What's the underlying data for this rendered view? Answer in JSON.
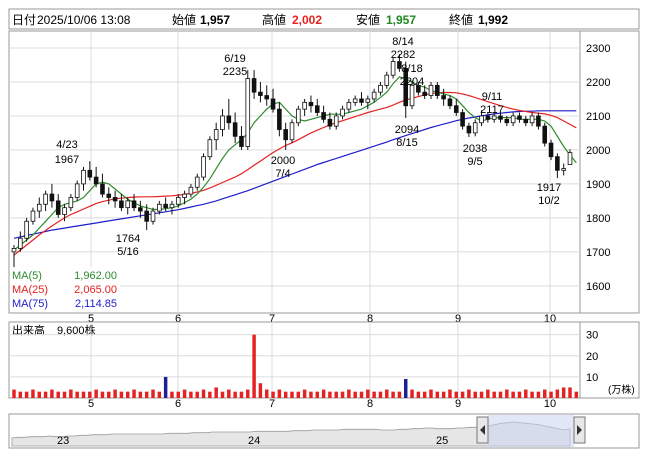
{
  "header": {
    "date_label": "日付",
    "date_value": "2025/10/06 13:08",
    "open_label": "始値",
    "open_value": "1,957",
    "high_label": "高値",
    "high_value": "2,002",
    "low_label": "安値",
    "low_value": "1,957",
    "close_label": "終値",
    "close_value": "1,992"
  },
  "legend": {
    "ma5_label": "MA(5)",
    "ma5_value": "1,962.00",
    "ma25_label": "MA(25)",
    "ma25_value": "2,065.00",
    "ma75_label": "MA(75)",
    "ma75_value": "2,114.85"
  },
  "volume_panel": {
    "title": "出来高",
    "value": "9,600株",
    "unit": "(万株)"
  },
  "annotations": [
    {
      "date": "4/23",
      "price": "1967"
    },
    {
      "date": "6/19",
      "price": "2235"
    },
    {
      "date": "5/16",
      "price": "1764"
    },
    {
      "date": "7/4",
      "price": "2000"
    },
    {
      "date": "8/14",
      "price": "2282"
    },
    {
      "date": "8/18",
      "price": "2204"
    },
    {
      "date": "8/15",
      "price": "2094"
    },
    {
      "date": "9/11",
      "price": "2117"
    },
    {
      "date": "9/5",
      "price": "2038"
    },
    {
      "date": "10/2",
      "price": "1917"
    }
  ],
  "navigator_labels": [
    "23",
    "24",
    "25"
  ],
  "colors": {
    "up": "#1e1e96",
    "down": "#e52222",
    "ma5": "#2e8b2e",
    "ma25": "#e52222",
    "ma75": "#1e1ec8",
    "volume": "#e52222"
  },
  "chart_data": {
    "type": "candlestick",
    "x_tick_labels": [
      "5",
      "6",
      "7",
      "8",
      "9",
      "10"
    ],
    "y_ticks": [
      1600,
      1700,
      1800,
      1900,
      2000,
      2100,
      2200,
      2300
    ],
    "ylim": [
      1520,
      2350
    ],
    "volume_ticks": [
      10,
      20,
      30
    ],
    "volume_ylim": [
      0,
      36
    ],
    "candles": [
      {
        "o": 1700,
        "h": 1720,
        "l": 1650,
        "c": 1710
      },
      {
        "o": 1710,
        "h": 1760,
        "l": 1700,
        "c": 1740
      },
      {
        "o": 1740,
        "h": 1800,
        "l": 1730,
        "c": 1790
      },
      {
        "o": 1790,
        "h": 1830,
        "l": 1780,
        "c": 1820
      },
      {
        "o": 1820,
        "h": 1860,
        "l": 1800,
        "c": 1840
      },
      {
        "o": 1840,
        "h": 1880,
        "l": 1820,
        "c": 1870
      },
      {
        "o": 1870,
        "h": 1900,
        "l": 1830,
        "c": 1850
      },
      {
        "o": 1850,
        "h": 1870,
        "l": 1800,
        "c": 1810
      },
      {
        "o": 1810,
        "h": 1840,
        "l": 1790,
        "c": 1830
      },
      {
        "o": 1830,
        "h": 1870,
        "l": 1820,
        "c": 1860
      },
      {
        "o": 1860,
        "h": 1910,
        "l": 1850,
        "c": 1900
      },
      {
        "o": 1900,
        "h": 1950,
        "l": 1880,
        "c": 1940
      },
      {
        "o": 1940,
        "h": 1967,
        "l": 1910,
        "c": 1920
      },
      {
        "o": 1920,
        "h": 1950,
        "l": 1890,
        "c": 1900
      },
      {
        "o": 1900,
        "h": 1930,
        "l": 1860,
        "c": 1870
      },
      {
        "o": 1870,
        "h": 1890,
        "l": 1840,
        "c": 1860
      },
      {
        "o": 1860,
        "h": 1880,
        "l": 1830,
        "c": 1850
      },
      {
        "o": 1850,
        "h": 1870,
        "l": 1820,
        "c": 1830
      },
      {
        "o": 1830,
        "h": 1860,
        "l": 1810,
        "c": 1850
      },
      {
        "o": 1850,
        "h": 1870,
        "l": 1820,
        "c": 1830
      },
      {
        "o": 1830,
        "h": 1850,
        "l": 1800,
        "c": 1820
      },
      {
        "o": 1820,
        "h": 1840,
        "l": 1764,
        "c": 1790
      },
      {
        "o": 1790,
        "h": 1830,
        "l": 1780,
        "c": 1820
      },
      {
        "o": 1820,
        "h": 1850,
        "l": 1810,
        "c": 1840
      },
      {
        "o": 1840,
        "h": 1860,
        "l": 1820,
        "c": 1830
      },
      {
        "o": 1830,
        "h": 1850,
        "l": 1810,
        "c": 1840
      },
      {
        "o": 1840,
        "h": 1870,
        "l": 1830,
        "c": 1860
      },
      {
        "o": 1860,
        "h": 1880,
        "l": 1840,
        "c": 1870
      },
      {
        "o": 1870,
        "h": 1900,
        "l": 1860,
        "c": 1890
      },
      {
        "o": 1890,
        "h": 1930,
        "l": 1880,
        "c": 1920
      },
      {
        "o": 1920,
        "h": 1990,
        "l": 1910,
        "c": 1980
      },
      {
        "o": 1980,
        "h": 2040,
        "l": 1970,
        "c": 2030
      },
      {
        "o": 2030,
        "h": 2080,
        "l": 2000,
        "c": 2060
      },
      {
        "o": 2060,
        "h": 2120,
        "l": 2040,
        "c": 2100
      },
      {
        "o": 2100,
        "h": 2150,
        "l": 2060,
        "c": 2080
      },
      {
        "o": 2080,
        "h": 2110,
        "l": 2020,
        "c": 2040
      },
      {
        "o": 2040,
        "h": 2070,
        "l": 2000,
        "c": 2010
      },
      {
        "o": 2010,
        "h": 2235,
        "l": 2000,
        "c": 2210
      },
      {
        "o": 2210,
        "h": 2235,
        "l": 2150,
        "c": 2170
      },
      {
        "o": 2170,
        "h": 2200,
        "l": 2140,
        "c": 2160
      },
      {
        "o": 2160,
        "h": 2190,
        "l": 2130,
        "c": 2150
      },
      {
        "o": 2150,
        "h": 2180,
        "l": 2110,
        "c": 2120
      },
      {
        "o": 2120,
        "h": 2140,
        "l": 2040,
        "c": 2060
      },
      {
        "o": 2060,
        "h": 2080,
        "l": 2000,
        "c": 2030
      },
      {
        "o": 2030,
        "h": 2090,
        "l": 2020,
        "c": 2080
      },
      {
        "o": 2080,
        "h": 2130,
        "l": 2070,
        "c": 2120
      },
      {
        "o": 2120,
        "h": 2150,
        "l": 2100,
        "c": 2140
      },
      {
        "o": 2140,
        "h": 2160,
        "l": 2110,
        "c": 2130
      },
      {
        "o": 2130,
        "h": 2150,
        "l": 2100,
        "c": 2110
      },
      {
        "o": 2110,
        "h": 2130,
        "l": 2080,
        "c": 2090
      },
      {
        "o": 2090,
        "h": 2110,
        "l": 2060,
        "c": 2070
      },
      {
        "o": 2070,
        "h": 2110,
        "l": 2060,
        "c": 2100
      },
      {
        "o": 2100,
        "h": 2130,
        "l": 2090,
        "c": 2120
      },
      {
        "o": 2120,
        "h": 2150,
        "l": 2110,
        "c": 2140
      },
      {
        "o": 2140,
        "h": 2160,
        "l": 2130,
        "c": 2150
      },
      {
        "o": 2150,
        "h": 2170,
        "l": 2130,
        "c": 2140
      },
      {
        "o": 2140,
        "h": 2160,
        "l": 2120,
        "c": 2150
      },
      {
        "o": 2150,
        "h": 2180,
        "l": 2140,
        "c": 2170
      },
      {
        "o": 2170,
        "h": 2200,
        "l": 2160,
        "c": 2190
      },
      {
        "o": 2190,
        "h": 2230,
        "l": 2180,
        "c": 2220
      },
      {
        "o": 2220,
        "h": 2270,
        "l": 2210,
        "c": 2260
      },
      {
        "o": 2260,
        "h": 2282,
        "l": 2230,
        "c": 2240
      },
      {
        "o": 2240,
        "h": 2260,
        "l": 2094,
        "c": 2130
      },
      {
        "o": 2130,
        "h": 2204,
        "l": 2120,
        "c": 2190
      },
      {
        "o": 2190,
        "h": 2200,
        "l": 2160,
        "c": 2170
      },
      {
        "o": 2170,
        "h": 2190,
        "l": 2150,
        "c": 2160
      },
      {
        "o": 2160,
        "h": 2200,
        "l": 2150,
        "c": 2190
      },
      {
        "o": 2190,
        "h": 2200,
        "l": 2150,
        "c": 2160
      },
      {
        "o": 2160,
        "h": 2180,
        "l": 2130,
        "c": 2150
      },
      {
        "o": 2150,
        "h": 2160,
        "l": 2120,
        "c": 2130
      },
      {
        "o": 2130,
        "h": 2150,
        "l": 2100,
        "c": 2110
      },
      {
        "o": 2110,
        "h": 2120,
        "l": 2060,
        "c": 2070
      },
      {
        "o": 2070,
        "h": 2080,
        "l": 2038,
        "c": 2050
      },
      {
        "o": 2050,
        "h": 2090,
        "l": 2040,
        "c": 2080
      },
      {
        "o": 2080,
        "h": 2117,
        "l": 2070,
        "c": 2100
      },
      {
        "o": 2100,
        "h": 2110,
        "l": 2080,
        "c": 2090
      },
      {
        "o": 2090,
        "h": 2110,
        "l": 2080,
        "c": 2100
      },
      {
        "o": 2100,
        "h": 2110,
        "l": 2080,
        "c": 2090
      },
      {
        "o": 2090,
        "h": 2100,
        "l": 2070,
        "c": 2080
      },
      {
        "o": 2080,
        "h": 2110,
        "l": 2070,
        "c": 2100
      },
      {
        "o": 2100,
        "h": 2110,
        "l": 2080,
        "c": 2090
      },
      {
        "o": 2090,
        "h": 2100,
        "l": 2070,
        "c": 2080
      },
      {
        "o": 2080,
        "h": 2110,
        "l": 2070,
        "c": 2100
      },
      {
        "o": 2100,
        "h": 2110,
        "l": 2060,
        "c": 2070
      },
      {
        "o": 2070,
        "h": 2080,
        "l": 2010,
        "c": 2020
      },
      {
        "o": 2020,
        "h": 2030,
        "l": 1970,
        "c": 1980
      },
      {
        "o": 1980,
        "h": 1990,
        "l": 1917,
        "c": 1940
      },
      {
        "o": 1940,
        "h": 1960,
        "l": 1925,
        "c": 1945
      },
      {
        "o": 1957,
        "h": 2002,
        "l": 1957,
        "c": 1992
      }
    ],
    "ma5": [
      1705,
      1720,
      1735,
      1750,
      1770,
      1790,
      1810,
      1830,
      1840,
      1845,
      1850,
      1860,
      1880,
      1900,
      1905,
      1900,
      1885,
      1870,
      1855,
      1845,
      1835,
      1830,
      1825,
      1825,
      1827,
      1830,
      1835,
      1845,
      1855,
      1870,
      1890,
      1915,
      1945,
      1975,
      2000,
      2015,
      2030,
      2050,
      2080,
      2100,
      2120,
      2135,
      2140,
      2120,
      2100,
      2090,
      2085,
      2090,
      2095,
      2100,
      2105,
      2105,
      2105,
      2110,
      2115,
      2120,
      2130,
      2140,
      2155,
      2170,
      2195,
      2215,
      2210,
      2200,
      2190,
      2185,
      2175,
      2170,
      2165,
      2160,
      2150,
      2130,
      2110,
      2095,
      2085,
      2090,
      2095,
      2095,
      2095,
      2095,
      2090,
      2090,
      2090,
      2090,
      2085,
      2070,
      2040,
      2010,
      1985,
      1962
    ],
    "ma25": [
      1690,
      1705,
      1720,
      1735,
      1750,
      1763,
      1776,
      1788,
      1800,
      1810,
      1818,
      1826,
      1834,
      1842,
      1848,
      1852,
      1856,
      1858,
      1860,
      1861,
      1862,
      1862,
      1862,
      1863,
      1864,
      1865,
      1867,
      1869,
      1872,
      1876,
      1881,
      1888,
      1896,
      1904,
      1912,
      1920,
      1930,
      1942,
      1955,
      1967,
      1980,
      1992,
      2003,
      2013,
      2021,
      2030,
      2040,
      2050,
      2058,
      2066,
      2074,
      2080,
      2086,
      2092,
      2098,
      2104,
      2110,
      2115,
      2120,
      2125,
      2132,
      2140,
      2147,
      2152,
      2157,
      2162,
      2166,
      2168,
      2169,
      2169,
      2168,
      2165,
      2160,
      2154,
      2148,
      2142,
      2136,
      2130,
      2125,
      2120,
      2116,
      2113,
      2110,
      2108,
      2106,
      2102,
      2095,
      2085,
      2075,
      2065
    ],
    "ma75": [
      1740,
      1744,
      1748,
      1752,
      1756,
      1760,
      1764,
      1767,
      1770,
      1773,
      1776,
      1779,
      1782,
      1785,
      1788,
      1791,
      1794,
      1797,
      1800,
      1803,
      1806,
      1809,
      1812,
      1815,
      1818,
      1821,
      1824,
      1828,
      1832,
      1836,
      1840,
      1845,
      1850,
      1856,
      1862,
      1868,
      1874,
      1880,
      1887,
      1894,
      1901,
      1908,
      1915,
      1922,
      1929,
      1936,
      1943,
      1950,
      1957,
      1963,
      1969,
      1975,
      1981,
      1987,
      1993,
      1999,
      2005,
      2011,
      2017,
      2023,
      2030,
      2036,
      2042,
      2048,
      2054,
      2060,
      2066,
      2071,
      2076,
      2081,
      2086,
      2090,
      2094,
      2097,
      2100,
      2103,
      2106,
      2108,
      2110,
      2112,
      2113,
      2114,
      2114,
      2115,
      2115,
      2115,
      2115,
      2115,
      2115,
      2115
    ],
    "volume": [
      4,
      3,
      3,
      4,
      3,
      3,
      4,
      3,
      3,
      4,
      3,
      3,
      3,
      4,
      3,
      3,
      4,
      3,
      3,
      4,
      3,
      3,
      4,
      3,
      10,
      3,
      3,
      4,
      3,
      3,
      4,
      3,
      5,
      3,
      4,
      3,
      3,
      4,
      30,
      7,
      4,
      3,
      4,
      3,
      3,
      3,
      4,
      3,
      3,
      4,
      3,
      3,
      3,
      4,
      3,
      3,
      4,
      3,
      3,
      4,
      3,
      3,
      9,
      4,
      3,
      3,
      4,
      3,
      3,
      4,
      3,
      3,
      4,
      3,
      3,
      4,
      3,
      3,
      4,
      3,
      3,
      4,
      3,
      3,
      4,
      3,
      4,
      5,
      5,
      3
    ],
    "navigator": [
      52,
      53,
      53,
      54,
      54,
      54,
      55,
      54,
      54,
      55,
      55,
      56,
      56,
      57,
      57,
      57,
      58,
      58,
      58,
      58,
      58,
      58,
      58,
      58,
      58,
      59,
      59,
      59,
      59,
      60,
      60,
      60,
      61,
      61,
      61,
      61,
      61,
      61,
      61,
      62,
      62,
      62,
      62,
      62,
      62,
      63,
      63,
      63,
      64,
      64,
      64,
      64,
      64,
      65,
      65,
      65,
      65,
      65,
      65,
      64,
      64,
      64,
      65,
      65,
      66,
      66,
      67,
      67,
      66,
      66,
      66,
      67,
      67,
      68,
      68,
      69,
      70,
      72,
      74,
      75,
      76,
      75,
      74,
      73,
      72,
      70,
      68,
      66,
      64,
      66
    ]
  }
}
